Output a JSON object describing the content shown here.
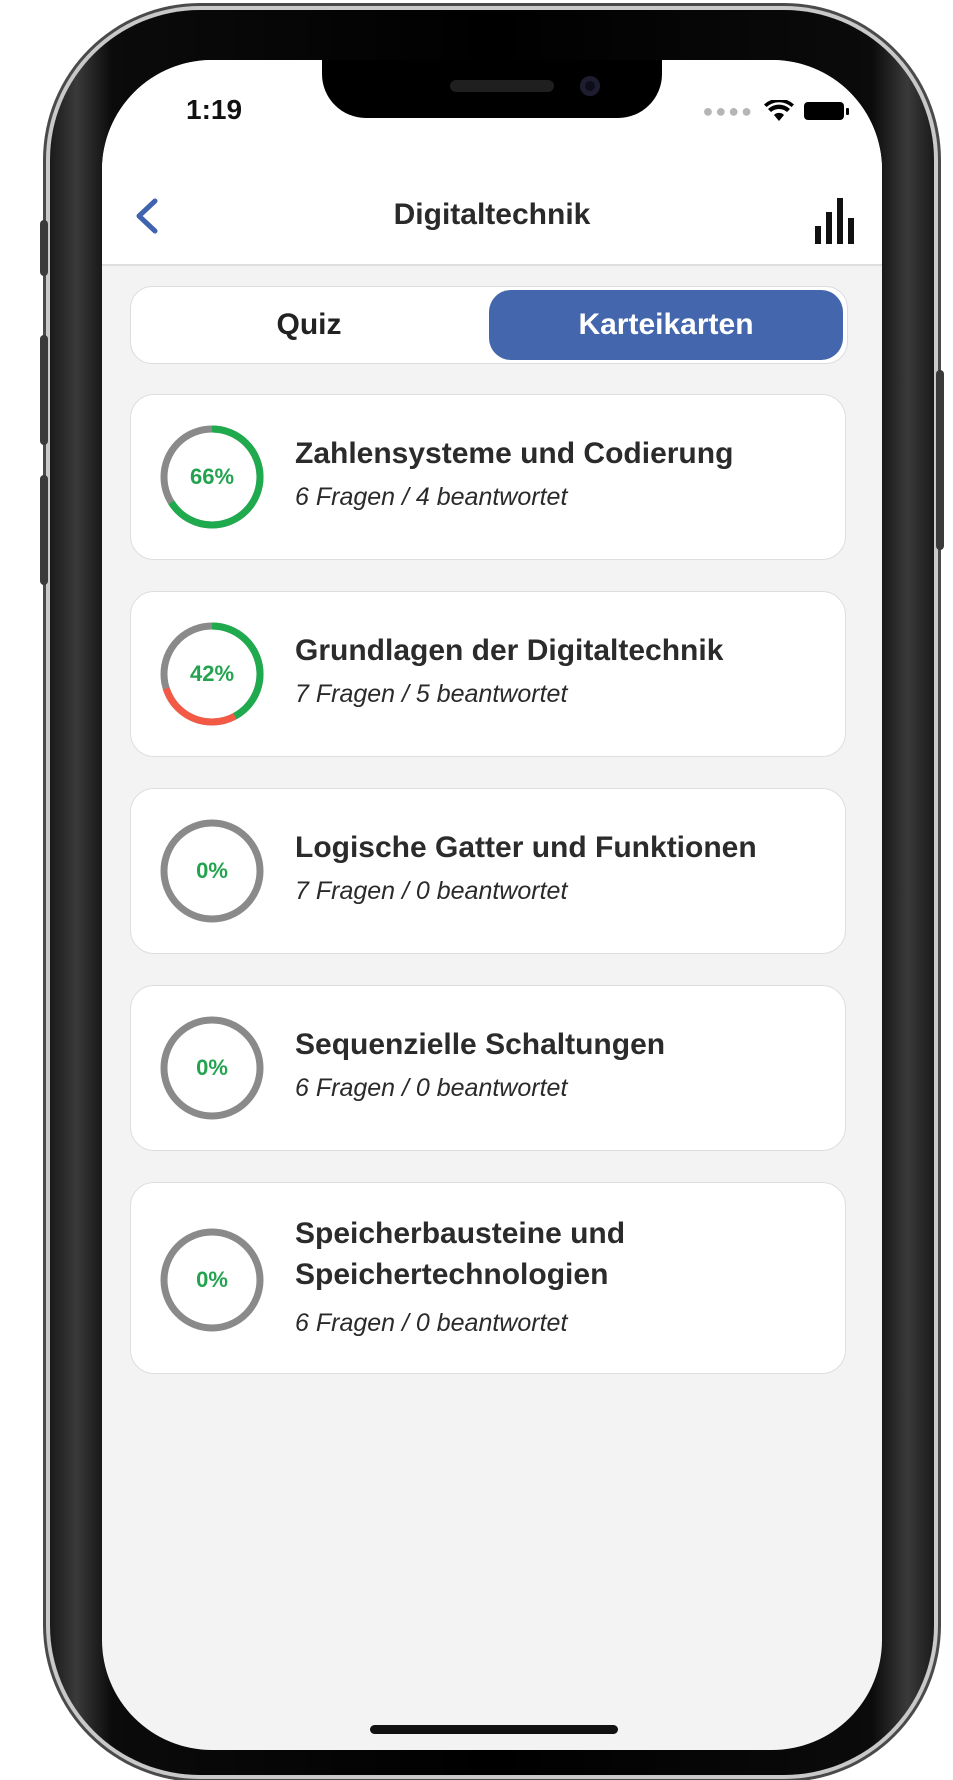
{
  "status": {
    "time": "1:19"
  },
  "nav": {
    "title": "Digitaltechnik",
    "back_icon": "chevron-left-icon",
    "stats_icon": "bar-chart-icon"
  },
  "tabs": {
    "quiz": "Quiz",
    "cards": "Karteikarten",
    "active": "Karteikarten"
  },
  "colors": {
    "accent": "#4366ad",
    "progress_green": "#1faa4d",
    "progress_red": "#f25a45",
    "ring_gray": "#8a8a8a"
  },
  "topics": [
    {
      "title": "Zahlensysteme und Codierung",
      "subtitle": "6 Fragen / 4 beantwortet",
      "percent_label": "66%",
      "correct_fraction": 0.66,
      "wrong_fraction": 0.0
    },
    {
      "title": "Grundlagen der Digitaltechnik",
      "subtitle": "7 Fragen / 5 beantwortet",
      "percent_label": "42%",
      "correct_fraction": 0.42,
      "wrong_fraction": 0.28
    },
    {
      "title": "Logische Gatter und Funktionen",
      "subtitle": "7 Fragen / 0 beantwortet",
      "percent_label": "0%",
      "correct_fraction": 0,
      "wrong_fraction": 0
    },
    {
      "title": "Sequenzielle Schaltungen",
      "subtitle": "6 Fragen / 0 beantwortet",
      "percent_label": "0%",
      "correct_fraction": 0,
      "wrong_fraction": 0
    },
    {
      "title": "Speicherbausteine und Speichertechnologien",
      "subtitle": "6 Fragen / 0 beantwortet",
      "percent_label": "0%",
      "correct_fraction": 0,
      "wrong_fraction": 0
    }
  ]
}
